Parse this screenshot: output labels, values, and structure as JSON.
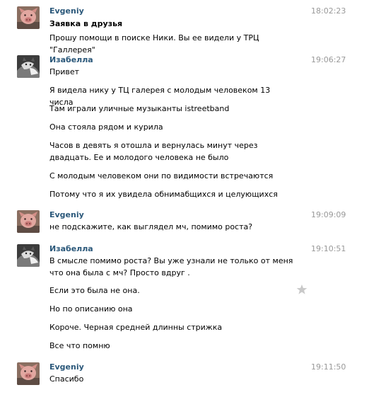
{
  "colors": {
    "author": "#2b587a",
    "time": "#999999",
    "star": "#c9c9c9"
  },
  "icons": {
    "favorite": "star-icon"
  },
  "messages": [
    {
      "author": "Evgeniy",
      "time": "18:02:23",
      "avatar": "pig-avatar",
      "lines": [
        "Заявка в друзья",
        "Прошу помощи в поиске Ники. Вы ее видели у ТРЦ \"Галлерея\""
      ]
    },
    {
      "author": "Изабелла",
      "time": "19:06:27",
      "avatar": "cat-avatar",
      "lines": [
        "Привет",
        "Я видела нику у ТЦ галерея с молодым человеком 13 числа",
        "Там играли уличные музыканты istreetband",
        "Она стояла рядом и курила",
        "Часов в девять я отошла и вернулась минут через двадцать. Ее и молодого человека не было",
        "С молодым человеком они по видимости встречаются",
        "Потому что я их увидела обнимабщихся и целующихся"
      ]
    },
    {
      "author": "Evgeniy",
      "time": "19:09:09",
      "avatar": "pig-avatar",
      "lines": [
        "не подскажите, как выглядел мч, помимо роста?"
      ]
    },
    {
      "author": "Изабелла",
      "time": "19:10:51",
      "avatar": "cat-avatar",
      "lines": [
        "В смысле помимо роста? Вы уже узнали не только от меня что она была с мч? Просто вдруг .",
        "Если это была не она.",
        "Но по описанию она",
        "Короче. Черная средней длинны стрижка",
        "Все что помню"
      ]
    },
    {
      "author": "Evgeniy",
      "time": "19:11:50",
      "avatar": "pig-avatar",
      "lines": [
        "Спасибо"
      ]
    }
  ]
}
